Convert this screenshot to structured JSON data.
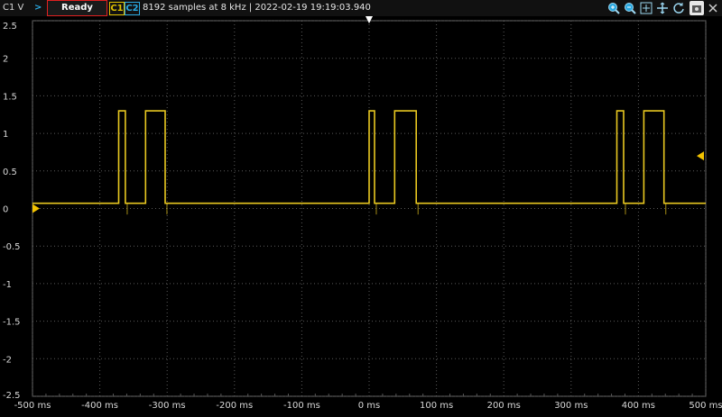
{
  "toolbar": {
    "channel_label": "C1 V",
    "run_arrow": ">",
    "status": "Ready",
    "channel1": "C1",
    "channel2": "C2",
    "acquisition_info": "8192 samples at 8 kHz | 2022-02-19 19:19:03.940"
  },
  "tools": [
    "zoom-in-icon",
    "zoom-out-icon",
    "auto-scale-icon",
    "pan-icon",
    "reset-icon",
    "screenshot-icon",
    "close-icon"
  ],
  "colors": {
    "trace": "#e8c820",
    "grid": "#5a5a5a",
    "marker": "#f2c200",
    "trigger_marker": "#ffffff",
    "c2": "#2aa8e0",
    "status_border": "#e02020"
  },
  "chart_data": {
    "type": "line",
    "xlabel_ticks": [
      "-500 ms",
      "-400 ms",
      "-300 ms",
      "-200 ms",
      "-100 ms",
      "0 ms",
      "100 ms",
      "200 ms",
      "300 ms",
      "400 ms",
      "500 ms"
    ],
    "ylabel_ticks": [
      "2.5",
      "2",
      "1.5",
      "1",
      "0.5",
      "0",
      "-0.5",
      "-1",
      "-1.5",
      "-2",
      "-2.5"
    ],
    "xlim_ms": [
      -500,
      500
    ],
    "ylim": [
      -2.5,
      2.5
    ],
    "grid": true,
    "series": [
      {
        "x": [
          -500,
          -372,
          -372,
          -362,
          -362,
          -332,
          -332,
          -303,
          -303,
          0,
          0,
          8,
          8,
          38,
          38,
          70,
          70,
          368,
          368,
          378,
          378,
          408,
          408,
          438,
          438,
          500
        ],
        "y": [
          0.07,
          0.07,
          1.3,
          1.3,
          0.07,
          0.07,
          1.3,
          1.3,
          0.07,
          0.07,
          1.3,
          1.3,
          0.07,
          0.07,
          1.3,
          1.3,
          0.07,
          0.07,
          1.3,
          1.3,
          0.07,
          0.07,
          1.3,
          1.3,
          0.07,
          0.07
        ]
      }
    ]
  }
}
